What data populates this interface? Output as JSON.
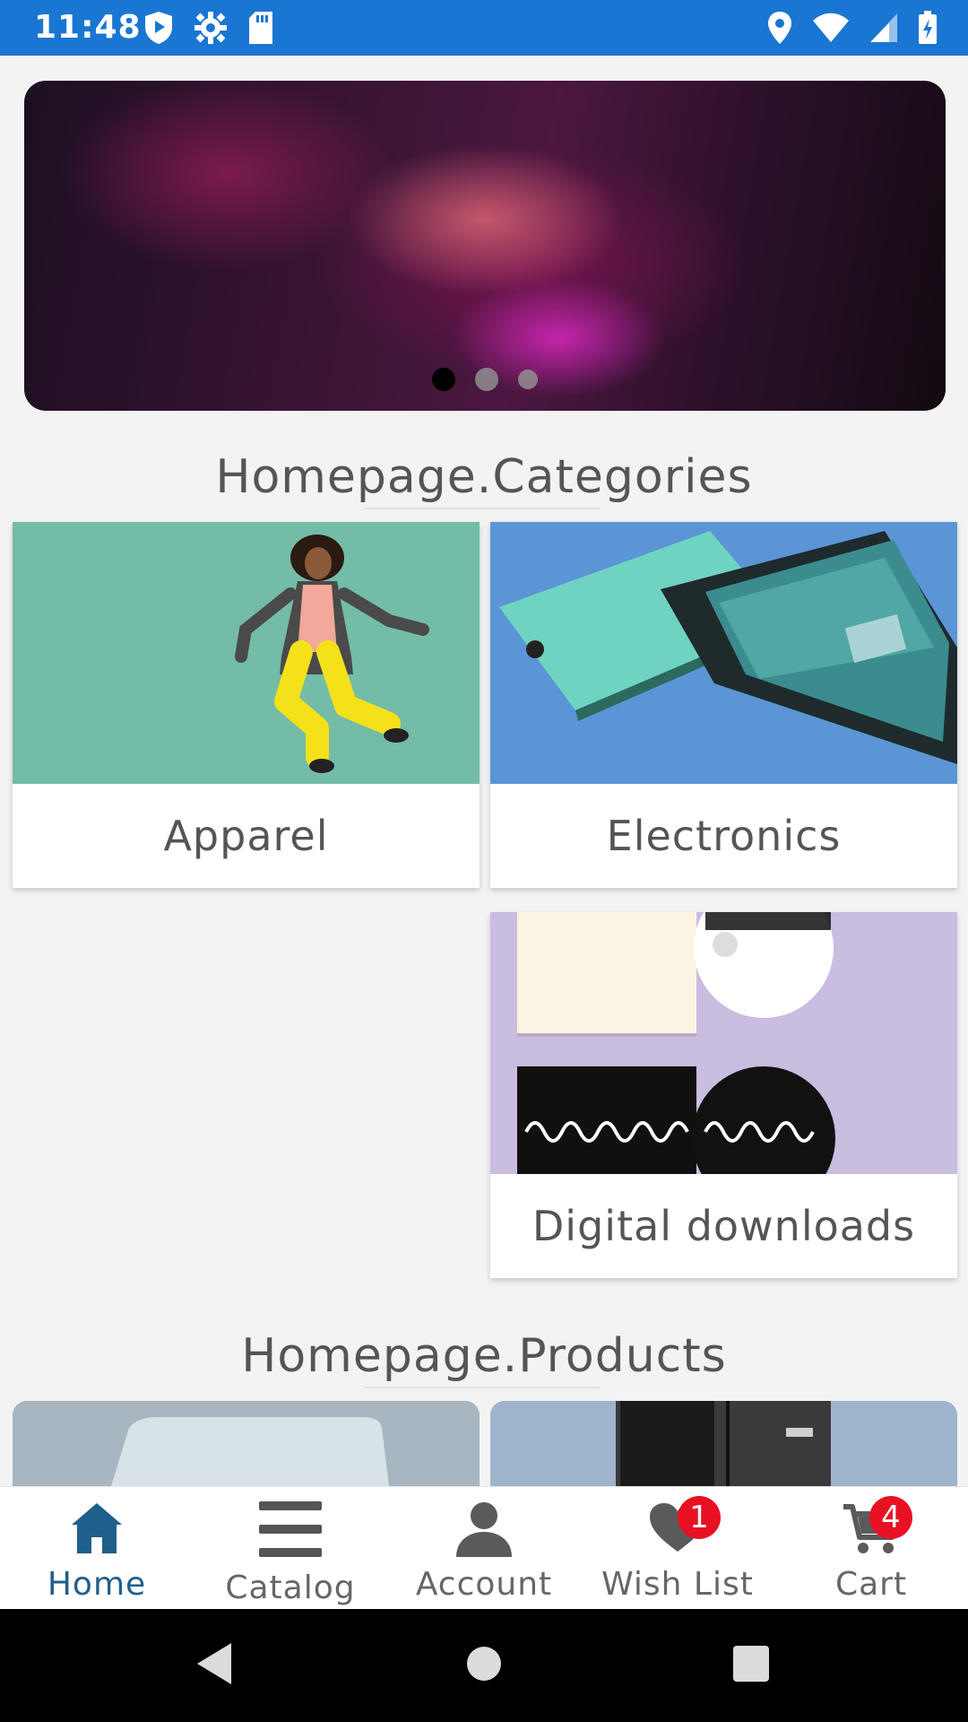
{
  "status_bar": {
    "time": "11:48",
    "left_icons": [
      "play-protect-icon",
      "gear-icon",
      "sd-card-icon"
    ],
    "right_icons": [
      "location-icon",
      "wifi-icon",
      "signal-icon",
      "battery-icon"
    ]
  },
  "banner": {
    "slide_count": 3,
    "active_index": 0
  },
  "categories": {
    "title": "Homepage.Categories",
    "items": [
      {
        "label": "Apparel"
      },
      {
        "label": "Electronics"
      },
      {
        "label": "Digital downloads"
      }
    ]
  },
  "products": {
    "title": "Homepage.Products"
  },
  "bottom_nav": {
    "items": [
      {
        "label": "Home",
        "icon": "home-icon",
        "active": true
      },
      {
        "label": "Catalog",
        "icon": "menu-icon",
        "active": false
      },
      {
        "label": "Account",
        "icon": "person-icon",
        "active": false
      },
      {
        "label": "Wish List",
        "icon": "heart-icon",
        "active": false,
        "badge": "1"
      },
      {
        "label": "Cart",
        "icon": "cart-icon",
        "active": false,
        "badge": "4"
      }
    ]
  },
  "colors": {
    "status_bar": "#1976d2",
    "active_nav": "#1f5f8b",
    "badge": "#e81123",
    "background": "#f3f3f3"
  }
}
